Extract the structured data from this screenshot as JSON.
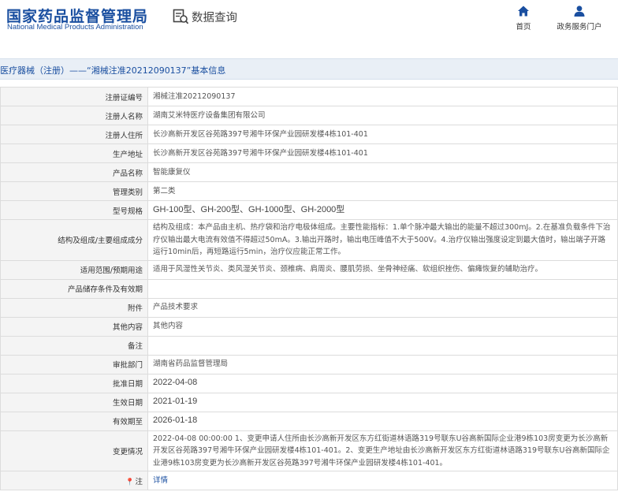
{
  "header": {
    "logo_cn": "国家药品监督管理局",
    "logo_en": "National Medical Products Administration",
    "query_label": "数据查询",
    "nav": [
      {
        "label": "首页",
        "icon": "home-icon"
      },
      {
        "label": "政务服务门户",
        "icon": "user-icon"
      }
    ]
  },
  "breadcrumb": "医疗器械（注册）——“湘械注准20212090137”基本信息",
  "colors": {
    "brand": "#1a4fa0",
    "crumb_bg": "#e9eff6",
    "label_bg": "#f4f4f4",
    "border": "#dcdcdc"
  },
  "rows": {
    "reg_no": {
      "label": "注册证编号",
      "value": "湘械注准20212090137"
    },
    "registrant": {
      "label": "注册人名称",
      "value": "湖南艾米特医疗设备集团有限公司"
    },
    "registrant_addr": {
      "label": "注册人住所",
      "value": "长沙高新开发区谷苑路397号湘牛环保产业园研发楼4栋101-401"
    },
    "prod_addr": {
      "label": "生产地址",
      "value": "长沙高新开发区谷苑路397号湘牛环保产业园研发楼4栋101-401"
    },
    "product_name": {
      "label": "产品名称",
      "value": "智能康复仪"
    },
    "category": {
      "label": "管理类别",
      "value": "第二类"
    },
    "model": {
      "label": "型号规格",
      "value": "GH-100型、GH-200型、GH-1000型、GH-2000型"
    },
    "structure": {
      "label": "结构及组成/主要组成成分",
      "value": "结构及组成：本产品由主机、热疗袋和治疗电极体组成。主要性能指标：1.单个脉冲最大输出的能量不超过300mJ。2.在基准负载条件下治疗仪输出最大电流有效值不得超过50mA。3.输出开路时，输出电压峰值不大于500V。4.治疗仪输出强度设定到最大值时，输出端子开路运行10min后，再短路运行5min，治疗仪应能正常工作。"
    },
    "scope": {
      "label": "适用范围/预期用途",
      "value": "适用于风湿性关节炎、类风湿关节炎、颈椎病、肩周炎、腰肌劳损、坐骨神经痛、软组织挫伤、偏瘫恢复的辅助治疗。"
    },
    "storage": {
      "label": "产品储存条件及有效期",
      "value": ""
    },
    "appendix": {
      "label": "附件",
      "value": "产品技术要求"
    },
    "other": {
      "label": "其他内容",
      "value": "其他内容"
    },
    "remark": {
      "label": "备注",
      "value": ""
    },
    "dept": {
      "label": "审批部门",
      "value": "湖南省药品监督管理局"
    },
    "approve_date": {
      "label": "批准日期",
      "value": "2022-04-08"
    },
    "effective_date": {
      "label": "生效日期",
      "value": "2021-01-19"
    },
    "expiry_date": {
      "label": "有效期至",
      "value": "2026-01-18"
    },
    "change": {
      "label": "变更情况",
      "value": "2022-04-08 00:00:00 1、变更申请人住所由长沙高新开发区东方红街道林语路319号联东U谷高新国际企业港9栋103房变更为长沙高新开发区谷苑路397号湘牛环保产业园研发楼4栋101-401。2、变更生产地址由长沙高新开发区东方红街道林语路319号联东U谷高新国际企业港9栋103房变更为长沙高新开发区谷苑路397号湘牛环保产业园研发楼4栋101-401。"
    },
    "note": {
      "label": "注",
      "value": "详情",
      "icon": "pin-icon"
    }
  }
}
